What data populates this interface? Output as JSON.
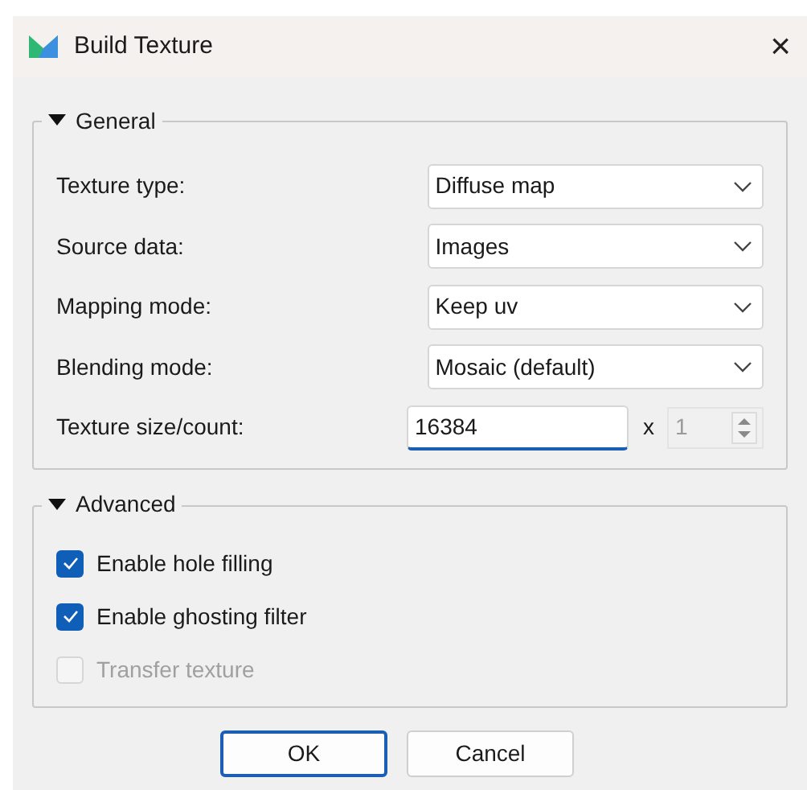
{
  "window": {
    "title": "Build Texture",
    "close": "×"
  },
  "sections": [
    {
      "title": "General",
      "expanded": true,
      "rows": [
        {
          "kind": "combo",
          "label": "Texture type:",
          "value": "Diffuse map"
        },
        {
          "kind": "combo",
          "label": "Source data:",
          "value": "Images"
        },
        {
          "kind": "combo",
          "label": "Mapping mode:",
          "value": "Keep uv"
        },
        {
          "kind": "combo",
          "label": "Blending mode:",
          "value": "Mosaic (default)"
        },
        {
          "kind": "size",
          "label": "Texture size/count:",
          "value": "16384",
          "separator": "x",
          "count": "1",
          "count_disabled": true
        }
      ]
    },
    {
      "title": "Advanced",
      "expanded": true,
      "rows": [
        {
          "kind": "checkbox",
          "label": "Enable hole filling",
          "checked": true,
          "disabled": false
        },
        {
          "kind": "checkbox",
          "label": "Enable ghosting filter",
          "checked": true,
          "disabled": false
        },
        {
          "kind": "checkbox",
          "label": "Transfer texture",
          "checked": false,
          "disabled": true
        }
      ]
    }
  ],
  "buttons": [
    {
      "label": "OK",
      "default": true
    },
    {
      "label": "Cancel",
      "default": false
    }
  ]
}
